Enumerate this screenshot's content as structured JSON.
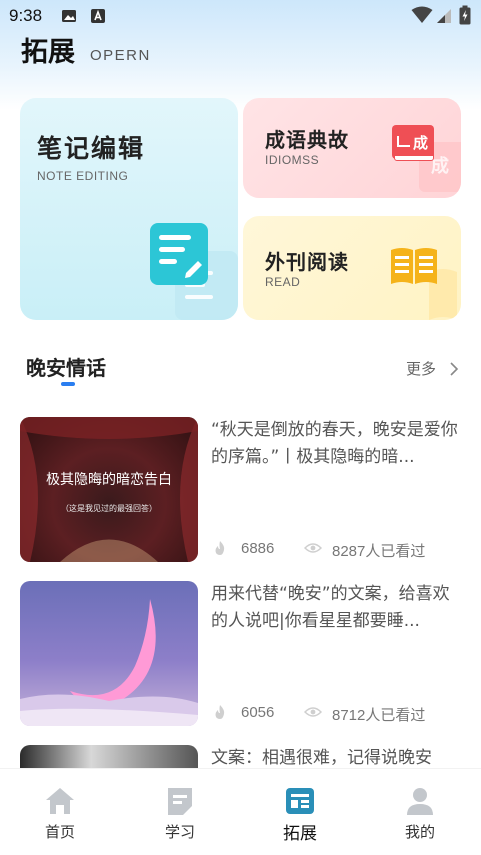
{
  "status_bar": {
    "time": "9:38"
  },
  "header": {
    "title": "拓展",
    "subtitle": "OPERN"
  },
  "cards": {
    "note": {
      "title": "笔记编辑",
      "subtitle": "NOTE EDITING"
    },
    "idiom": {
      "title": "成语典故",
      "subtitle": "IDIOMSS",
      "icon_text": "成"
    },
    "read": {
      "title": "外刊阅读",
      "subtitle": "READ"
    }
  },
  "section": {
    "title": "晚安情话",
    "more": "更多"
  },
  "articles": [
    {
      "title": "“秋天是倒放的春天，晚安是爱你的序篇。”丨极其隐晦的暗...",
      "likes": "6886",
      "views": "8287人已看过",
      "thumb_caption": "极其隐晦的暗恋告白",
      "thumb_subcaption": "（这是我见过的最强回答）"
    },
    {
      "title": "用来代替“晚安”的文案，给喜欢的人说吧|你看星星都要睡...",
      "likes": "6056",
      "views": "8712人已看过"
    },
    {
      "title": "文案：相遇很难，记得说晚安"
    }
  ],
  "tabbar": {
    "items": [
      {
        "label": "首页",
        "icon": "home-icon"
      },
      {
        "label": "学习",
        "icon": "study-icon"
      },
      {
        "label": "拓展",
        "icon": "expand-icon",
        "active": true
      },
      {
        "label": "我的",
        "icon": "profile-icon"
      }
    ]
  },
  "colors": {
    "accent": "#2a7ef0",
    "active_tab": "#2a8fb8"
  }
}
